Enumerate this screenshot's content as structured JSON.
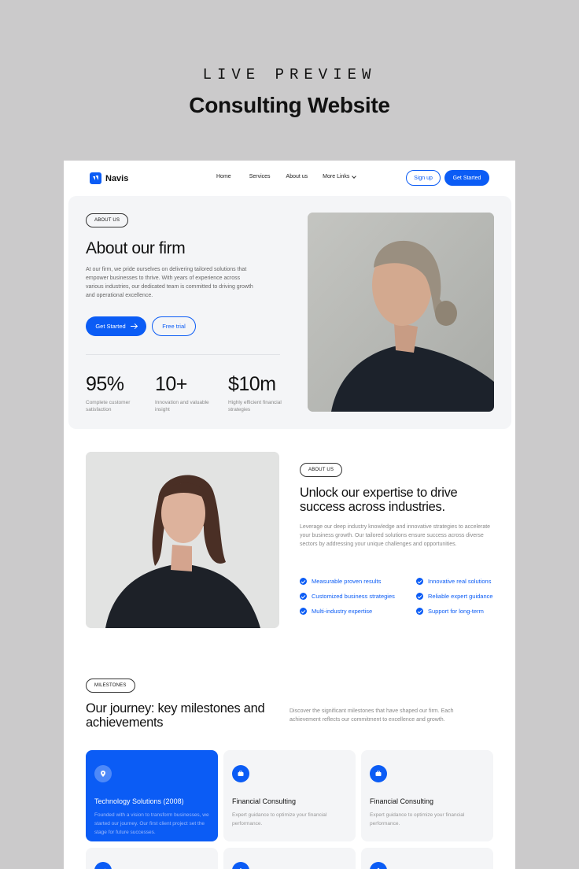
{
  "page": {
    "eyebrow": "LIVE PREVIEW",
    "title": "Consulting Website"
  },
  "nav": {
    "logo": "Navis",
    "links": {
      "home": "Home",
      "services": "Services",
      "about": "About us",
      "more": "More Links"
    },
    "signup": "Sign up",
    "get_started": "Get Started"
  },
  "hero": {
    "pill": "ABOUT US",
    "title": "About our firm",
    "description": "At our firm, we pride ourselves on delivering tailored solutions that empower businesses to thrive. With years of experience across various industries, our dedicated team is committed to driving growth and operational excellence.",
    "primary_button": "Get Started",
    "secondary_button": "Free trial",
    "stats": [
      {
        "value": "95%",
        "label": "Complete customer satisfaction"
      },
      {
        "value": "10+",
        "label": "Innovation and valuable insight"
      },
      {
        "value": "$10m",
        "label": "Highly efficient financial strategies"
      }
    ]
  },
  "expertise": {
    "pill": "ABOUT US",
    "title": "Unlock our expertise to drive success across industries.",
    "description": "Leverage our deep industry knowledge and innovative strategies to accelerate your business growth. Our tailored solutions ensure success across diverse sectors by addressing your unique challenges and opportunities.",
    "features": [
      "Measurable proven results",
      "Innovative real solutions",
      "Customized business strategies",
      "Reliable expert guidance",
      "Multi-industry expertise",
      "Support for long-term"
    ]
  },
  "milestones": {
    "pill": "MILESTONES",
    "title": "Our journey: key milestones and achievements",
    "description": "Discover the significant milestones that have shaped our firm. Each achievement reflects our commitment to excellence and growth.",
    "cards": [
      {
        "title": "Technology Solutions (2008)",
        "description": "Founded with a vision to transform businesses, we started our journey. Our first client project set the stage for future successes.",
        "icon": "location-pin-icon"
      },
      {
        "title": "Financial Consulting",
        "description": "Expert guidance to optimize your financial performance.",
        "icon": "briefcase-icon"
      },
      {
        "title": "Financial Consulting",
        "description": "Expert guidance to optimize your financial performance.",
        "icon": "briefcase-icon"
      }
    ]
  },
  "colors": {
    "accent": "#0b5cf5",
    "background": "#cbcacb",
    "panel": "#f4f5f7"
  }
}
